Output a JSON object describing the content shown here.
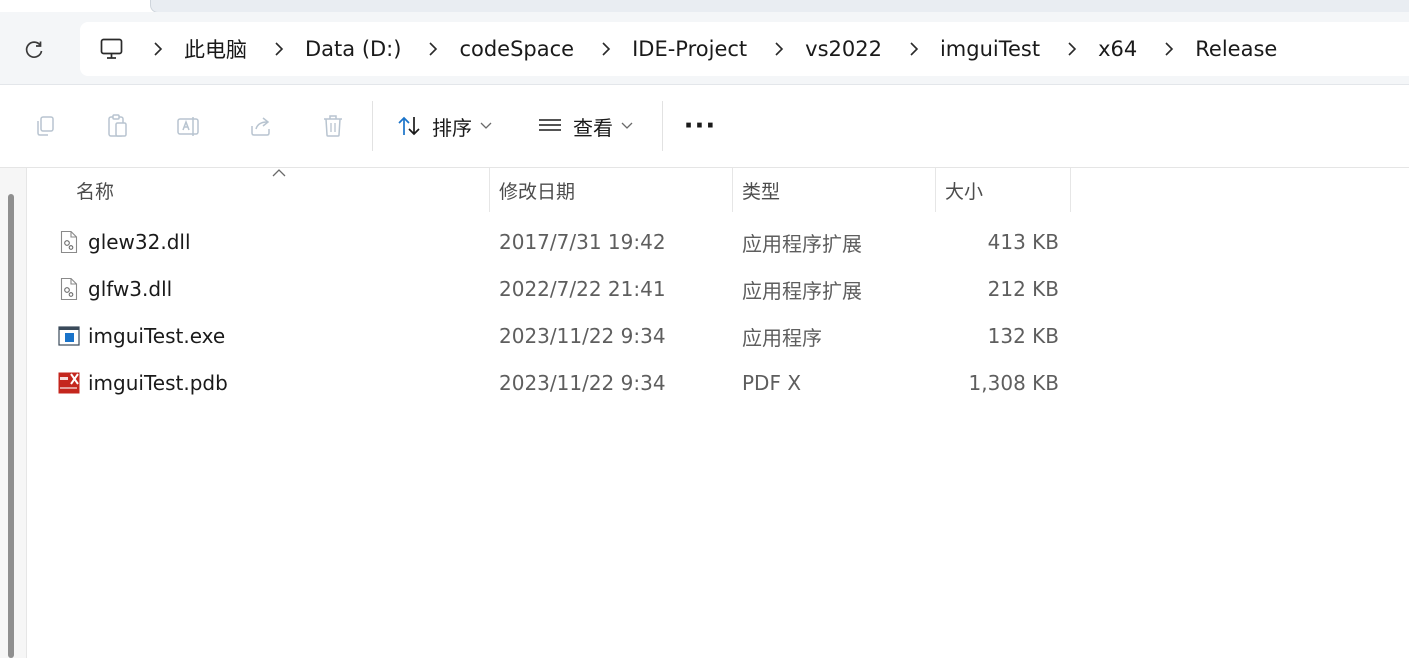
{
  "breadcrumb": {
    "items": [
      "此电脑",
      "Data (D:)",
      "codeSpace",
      "IDE-Project",
      "vs2022",
      "imguiTest",
      "x64",
      "Release"
    ]
  },
  "toolbar": {
    "sort_label": "排序",
    "view_label": "查看",
    "more_label": "···"
  },
  "columns": {
    "name": "名称",
    "date": "修改日期",
    "type": "类型",
    "size": "大小"
  },
  "files": [
    {
      "name": "glew32.dll",
      "date": "2017/7/31 19:42",
      "type": "应用程序扩展",
      "size": "413 KB",
      "icon": "dll-icon"
    },
    {
      "name": "glfw3.dll",
      "date": "2022/7/22 21:41",
      "type": "应用程序扩展",
      "size": "212 KB",
      "icon": "dll-icon"
    },
    {
      "name": "imguiTest.exe",
      "date": "2023/11/22 9:34",
      "type": "应用程序",
      "size": "132 KB",
      "icon": "exe-icon"
    },
    {
      "name": "imguiTest.pdb",
      "date": "2023/11/22 9:34",
      "type": "PDF X",
      "size": "1,308 KB",
      "icon": "pdf-icon"
    }
  ],
  "icons": {
    "refresh": "refresh-icon",
    "computer": "computer-icon",
    "copy": "copy-icon",
    "paste": "paste-icon",
    "rename": "rename-icon",
    "share": "share-icon",
    "delete": "delete-icon",
    "sort": "sort-icon",
    "view": "view-icon"
  },
  "colors": {
    "accent_blue": "#1a73c9",
    "pdf_red": "#c4261d",
    "disabled_icon": "#b8c4d0"
  }
}
